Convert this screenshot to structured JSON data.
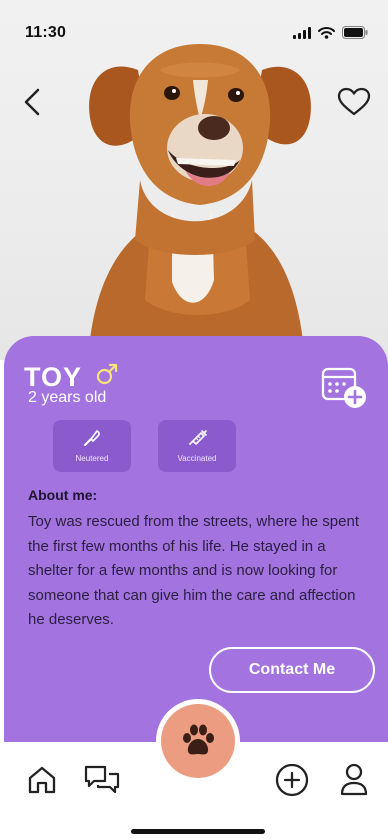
{
  "status_bar": {
    "time": "11:30"
  },
  "header": {
    "back_icon": "chevron-left-icon",
    "favorite_icon": "heart-outline-icon"
  },
  "pet": {
    "name": "TOY",
    "gender_icon": "male-symbol-icon",
    "age": "2 years old",
    "tags": [
      {
        "label": "Neutered",
        "icon": "scalpel-icon"
      },
      {
        "label": "Vaccinated",
        "icon": "syringe-icon"
      }
    ],
    "about_heading": "About me:",
    "about_text": "Toy was rescued from the streets, where he spent the first few months of his life. He stayed in a shelter for a few months and is now looking for someone that can give him the care and affection he deserves."
  },
  "actions": {
    "contact_label": "Contact Me",
    "calendar_icon": "calendar-add-icon"
  },
  "bottom_nav": {
    "items": [
      {
        "icon": "home-icon"
      },
      {
        "icon": "chat-icon"
      },
      {
        "icon": "paw-icon"
      },
      {
        "icon": "plus-circle-icon"
      },
      {
        "icon": "user-icon"
      }
    ]
  },
  "colors": {
    "card": "#a373e0",
    "fab": "#ec9c80",
    "text_dark": "#2a1f3f",
    "white": "#ffffff"
  }
}
